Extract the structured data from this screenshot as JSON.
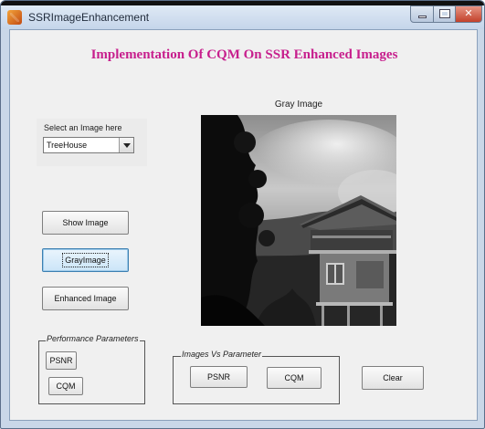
{
  "window": {
    "title": "SSRImageEnhancement"
  },
  "heading": "Implementation Of CQM On SSR Enhanced Images",
  "image_selector": {
    "label": "Select an Image here",
    "selected": "TreeHouse"
  },
  "buttons": {
    "show_image": "Show Image",
    "gray_image": "GrayImage",
    "enhanced_image": "Enhanced Image",
    "clear": "Clear"
  },
  "image_panel": {
    "caption": "Gray Image"
  },
  "performance_parameters": {
    "title": "Performance Parameters",
    "psnr": "PSNR",
    "cqm": "CQM"
  },
  "images_vs_parameter": {
    "title": "Images Vs Parameter",
    "psnr": "PSNR",
    "cqm": "CQM"
  }
}
